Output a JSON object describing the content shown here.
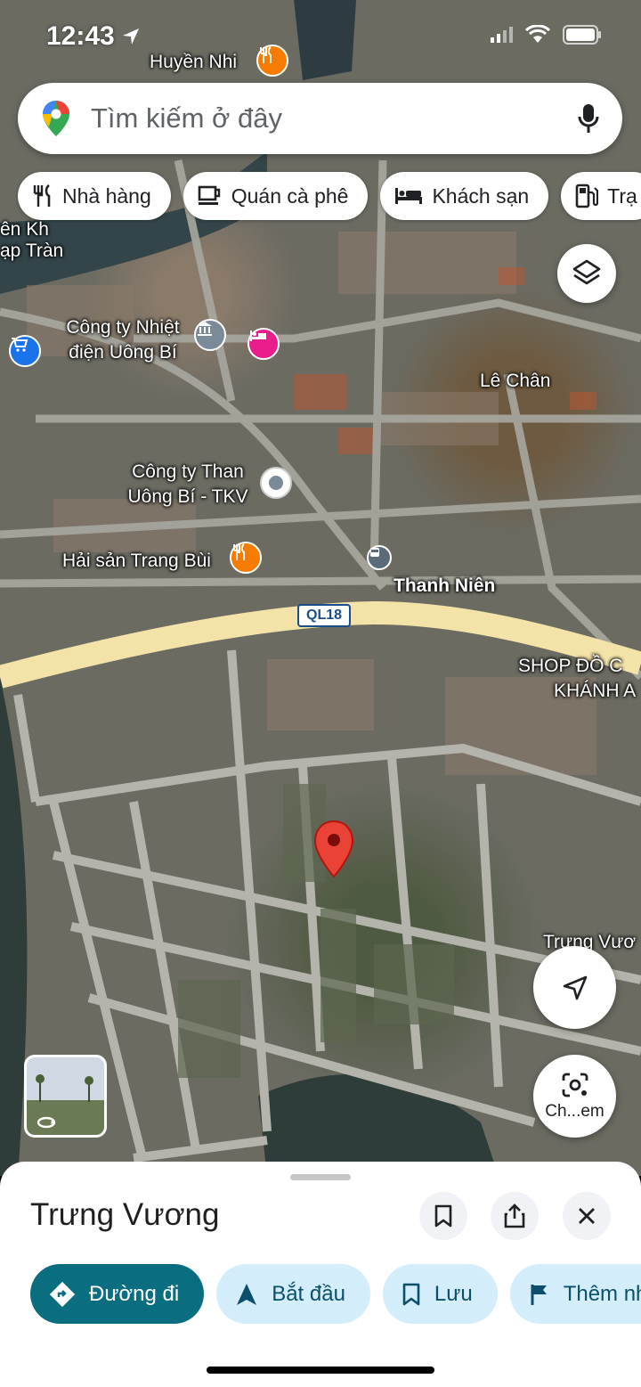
{
  "status_bar": {
    "time": "12:43"
  },
  "search": {
    "placeholder": "Tìm kiếm ở đây"
  },
  "chips": [
    {
      "label": "Nhà hàng",
      "icon": "fork-knife-icon"
    },
    {
      "label": "Quán cà phê",
      "icon": "coffee-cup-icon"
    },
    {
      "label": "Khách sạn",
      "icon": "bed-icon"
    },
    {
      "label": "Trạ",
      "icon": "gas-station-icon"
    }
  ],
  "map": {
    "labels": {
      "huyen_nhi": "Huyền Nhi",
      "cong_ty_nhiet_1": "Công ty Nhiệt",
      "cong_ty_nhiet_2": "điện Uông Bí",
      "cong_ty_than_1": "Công ty Than",
      "cong_ty_than_2": "Uông Bí - TKV",
      "hai_san": "Hải sản Trang Bùi",
      "thanh_nien": "Thanh Niên",
      "le_chan": "Lê Chân",
      "shop_1": "SHOP ĐỒ C",
      "shop_2": "KHÁNH A",
      "trung_vuong_map_1": "Trưng Vươ",
      "trung_vuong_map_2": "C",
      "left_road_1": "ên Kh",
      "left_road_2": "ạp Tràn",
      "ql18": "QL18"
    }
  },
  "camera_button": {
    "label": "Ch...em"
  },
  "place": {
    "title": "Trưng Vương"
  },
  "actions": [
    {
      "label": "Đường đi",
      "icon": "directions-icon",
      "primary": true
    },
    {
      "label": "Bắt đầu",
      "icon": "navigation-arrow-icon",
      "primary": false
    },
    {
      "label": "Lưu",
      "icon": "bookmark-icon",
      "primary": false
    },
    {
      "label": "Thêm nh",
      "icon": "flag-icon",
      "primary": false
    }
  ],
  "colors": {
    "primary_action": "#0b6e80",
    "secondary_action": "#d3eefa",
    "poi_orange": "#f57c00",
    "poi_pink": "#e91e8c",
    "pin_red": "#ea4335",
    "highway": "#f3e3a8"
  }
}
